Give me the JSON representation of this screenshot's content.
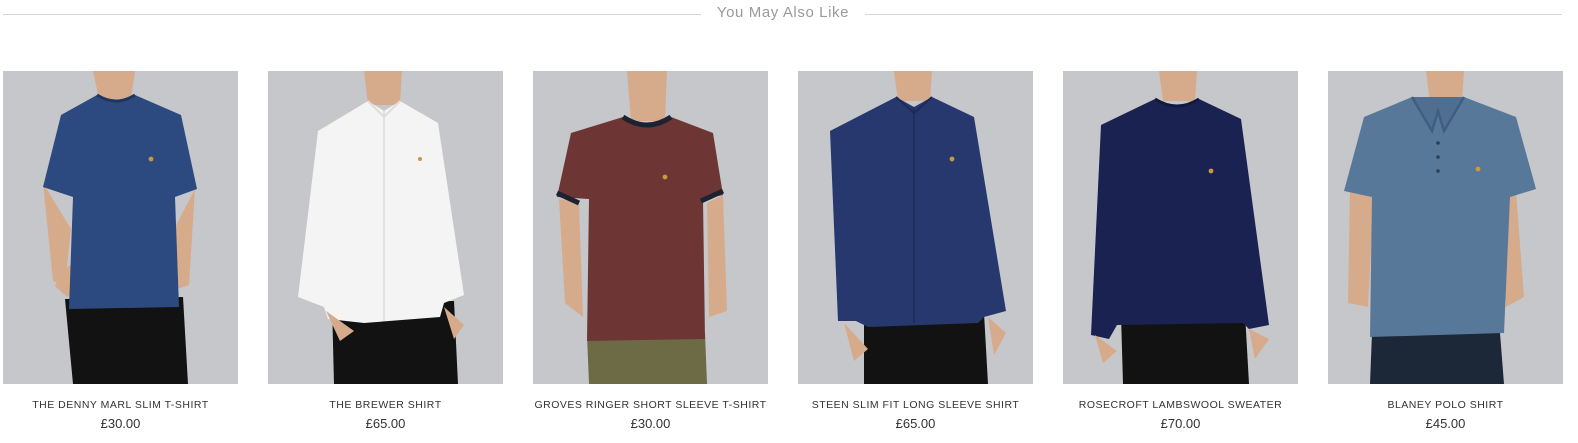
{
  "section": {
    "title": "You May Also Like"
  },
  "colors": {
    "image_background": "#c6c7ca",
    "text": "#333333",
    "rule": "#d6d6d6",
    "header_text": "#9a9a9a"
  },
  "products": [
    {
      "name": "THE DENNY MARL SLIM T-SHIRT",
      "price": "£30.00",
      "garment": "crew-neck short-sleeve t-shirt",
      "garment_color": "#2c4a80",
      "pants_color": "#121212"
    },
    {
      "name": "THE BREWER SHIRT",
      "price": "£65.00",
      "garment": "button-down long-sleeve shirt",
      "garment_color": "#f4f4f4",
      "pants_color": "#121212"
    },
    {
      "name": "GROVES RINGER SHORT SLEEVE T-SHIRT",
      "price": "£30.00",
      "garment": "ringer t-shirt with contrast trim",
      "garment_color": "#6e3535",
      "trim_color": "#1d2230",
      "pants_color": "#6d6b46"
    },
    {
      "name": "STEEN SLIM FIT LONG SLEEVE SHIRT",
      "price": "£65.00",
      "garment": "long-sleeve button shirt",
      "garment_color": "#27386f",
      "pants_color": "#121212"
    },
    {
      "name": "ROSECROFT LAMBSWOOL SWEATER",
      "price": "£70.00",
      "garment": "crew-neck knit sweater",
      "garment_color": "#192250",
      "pants_color": "#121212"
    },
    {
      "name": "BLANEY POLO SHIRT",
      "price": "£45.00",
      "garment": "short-sleeve polo shirt",
      "garment_color": "#58789a",
      "pants_color": "#1c2837"
    }
  ]
}
